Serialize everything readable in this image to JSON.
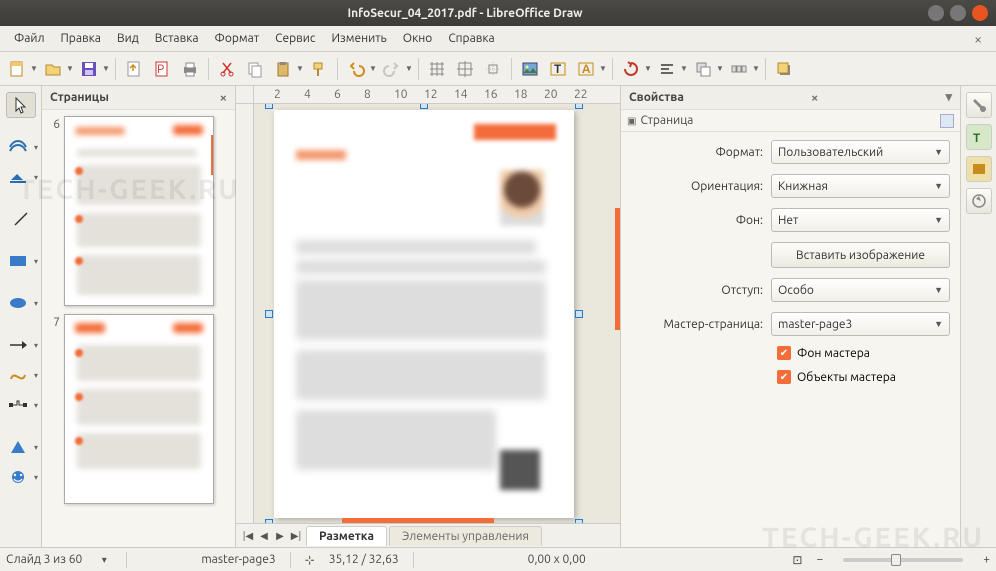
{
  "window": {
    "title": "InfoSecur_04_2017.pdf - LibreOffice Draw"
  },
  "menu": {
    "items": [
      "Файл",
      "Правка",
      "Вид",
      "Вставка",
      "Формат",
      "Сервис",
      "Изменить",
      "Окно",
      "Справка"
    ]
  },
  "pagesPanel": {
    "title": "Страницы",
    "thumbs": [
      6,
      7
    ]
  },
  "tabs": {
    "nav": [
      "|◀",
      "◀",
      "▶",
      "▶|"
    ],
    "active": "Разметка",
    "inactive": "Элементы управления"
  },
  "props": {
    "title": "Свойства",
    "section": "Страница",
    "format": {
      "label": "Формат:",
      "value": "Пользовательский"
    },
    "orientation": {
      "label": "Ориентация:",
      "value": "Книжная"
    },
    "background": {
      "label": "Фон:",
      "value": "Нет"
    },
    "insertImage": {
      "label": "Вставить изображение"
    },
    "margin": {
      "label": "Отступ:",
      "value": "Особо"
    },
    "masterPage": {
      "label": "Мастер-страница:",
      "value": "master-page3"
    },
    "chkMasterBg": "Фон мастера",
    "chkMasterObj": "Объекты мастера"
  },
  "ruler": {
    "marks": [
      2,
      4,
      6,
      8,
      10,
      12,
      14,
      16,
      18,
      20,
      22
    ]
  },
  "status": {
    "slide": "Слайд 3 из 60",
    "master": "master-page3",
    "cursor": "35,12 / 32,63",
    "size": "0,00 x 0,00"
  },
  "watermark": "TECH-GEEK.RU"
}
